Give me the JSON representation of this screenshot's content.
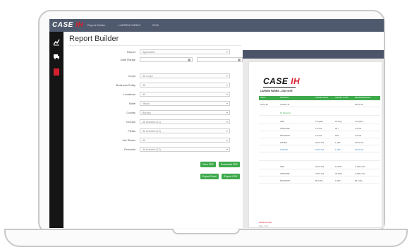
{
  "topbar": {
    "brand_main": "CASE",
    "brand_mark": "IH",
    "crumbs": [
      "Report Builder",
      "LARSEN FARMS",
      "2019"
    ],
    "color": "#505a6e"
  },
  "sidebar": {
    "icons": [
      "chart-icon",
      "truck-icon",
      "square-red-icon"
    ],
    "color": "#151515",
    "accent": "#d6202f"
  },
  "page": {
    "title": "Report Builder"
  },
  "form": {
    "fields": [
      {
        "label": "Report",
        "value": "Application"
      },
      {
        "label": "Date Range",
        "value": "",
        "value2": ""
      },
      {
        "label": "Crops",
        "value": "All Crops"
      },
      {
        "label": "Business Entity",
        "value": "All"
      },
      {
        "label": "Locations",
        "value": "All"
      },
      {
        "label": "State",
        "value": "Illinois"
      },
      {
        "label": "County",
        "value": "Bureau"
      },
      {
        "label": "Groups",
        "value": "All selected (12)"
      },
      {
        "label": "Fields",
        "value": "All selected (12)"
      },
      {
        "label": "Job Status",
        "value": "All"
      },
      {
        "label": "Products",
        "value": "All selected (12)"
      }
    ],
    "buttons": [
      {
        "label": "View PDF"
      },
      {
        "label": "Download PDF"
      },
      {
        "label": "Export Excel"
      },
      {
        "label": "Export CSV"
      }
    ],
    "accent": "#3eaa4c"
  },
  "preview": {
    "logo_main": "CASE",
    "logo_mark": "IH",
    "subtitle": "LARSEN FARMS - 2019 SITE",
    "columns": [
      "FIELD",
      "PRODUCT",
      "TARGET RATE",
      "TARGET TOTAL",
      "MEASURED RATE"
    ],
    "rows": [
      {
        "c": [
          "North 80",
          "COLBY 15",
          "",
          "",
          "200.0 Ha"
        ],
        "style": [
          "",
          "",
          "",
          "",
          ""
        ]
      },
      {
        "c": [
          "",
          "12 Products",
          "",
          "",
          ""
        ],
        "style": [
          "",
          "g",
          "",
          "",
          ""
        ]
      },
      {
        "c": [
          "",
          "AMS",
          "2.0 gal/a",
          "24.0 kg",
          "2.0 kg/ha"
        ],
        "style": [
          "",
          "",
          "",
          "",
          ""
        ]
      },
      {
        "c": [
          "",
          "ATRAZINE",
          "1.0 l/ha",
          "90 l",
          "1.0 l/ha"
        ],
        "style": [
          "",
          "",
          "",
          "",
          ""
        ]
      },
      {
        "c": [
          "",
          "ROUNDUP",
          "2.0 l/ha",
          "180 l",
          "2.0 l/ha"
        ],
        "style": [
          "",
          "",
          "",
          "",
          ""
        ]
      },
      {
        "c": [
          "",
          "WATER",
          "100.0 l/ha",
          "1,100 l",
          "100.0 l/ha"
        ],
        "style": [
          "",
          "",
          "",
          "",
          ""
        ]
      },
      {
        "c": [
          "",
          "Total Mix",
          "100.0 l/ha",
          "1,100 l",
          "100.0 l/ha"
        ],
        "style": [
          "",
          "b",
          "b",
          "b",
          "b"
        ]
      },
      {
        "c": [
          "",
          "",
          "",
          "",
          ""
        ],
        "style": [
          "",
          "",
          "",
          "",
          ""
        ]
      },
      {
        "c": [
          "",
          "AMS",
          "100.0 l/ha",
          "11,575 l",
          "1,100.0 l/ha"
        ],
        "style": [
          "",
          "",
          "",
          "",
          ""
        ]
      },
      {
        "c": [
          "",
          "ATRAZINE",
          "275.0 l/ha",
          "32,000 l",
          "1,250.0 l/ha"
        ],
        "style": [
          "",
          "",
          "",
          "",
          ""
        ]
      },
      {
        "c": [
          "",
          "ROUNDUP",
          "80.0 l/ha",
          "1,500 l",
          "80.0 l/ha"
        ],
        "style": [
          "",
          "",
          "",
          "",
          ""
        ]
      }
    ],
    "note": "Additional notes",
    "meta": "Page 1 of 1"
  }
}
